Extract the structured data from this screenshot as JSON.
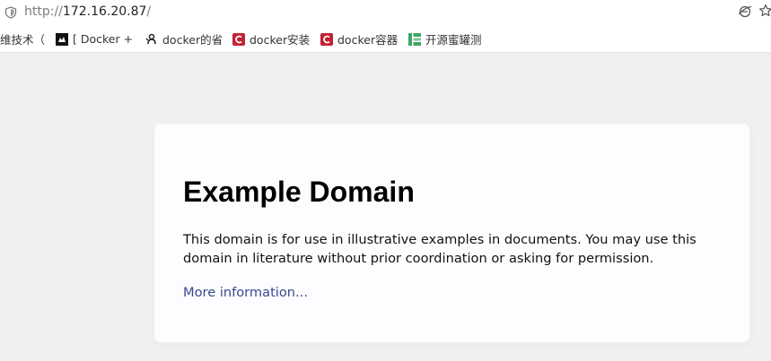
{
  "browser": {
    "url": {
      "scheme": "http://",
      "host": "172.16.20.87",
      "path": "/"
    },
    "icons": {
      "security": "shield-icon",
      "reader": "reader-mode-icon",
      "bookmark": "star-icon"
    }
  },
  "bookmarks": [
    {
      "label": "维技术（",
      "icon": "none"
    },
    {
      "label": "[ Docker +",
      "icon": "docker-hub-icon"
    },
    {
      "label": "docker的省",
      "icon": "github-icon"
    },
    {
      "label": "docker安装",
      "icon": "csdn-icon",
      "color": "#c32136"
    },
    {
      "label": "docker容器",
      "icon": "csdn-icon",
      "color": "#c32136"
    },
    {
      "label": "开源蜜罐测",
      "icon": "green-doc-icon",
      "color": "#3fa565"
    }
  ],
  "page": {
    "title": "Example Domain",
    "description": "This domain is for use in illustrative examples in documents. You may use this domain in literature without prior coordination or asking for permission.",
    "link_label": "More information...",
    "colors": {
      "background": "#f0f0f2",
      "card": "#fdfdff",
      "link": "#38488f"
    }
  }
}
